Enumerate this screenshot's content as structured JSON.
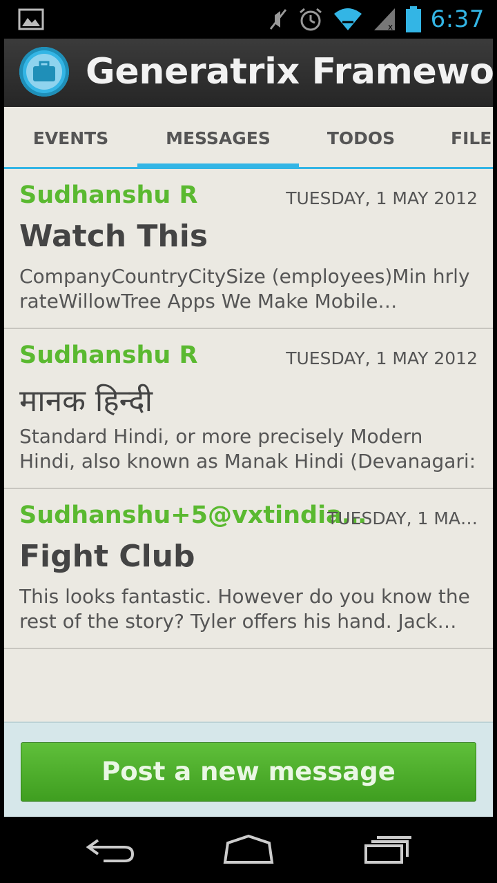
{
  "status_bar": {
    "time": "6:37",
    "icons": [
      "gallery-notification-icon",
      "mute-icon",
      "alarm-icon",
      "wifi-icon",
      "signal-icon",
      "battery-icon"
    ]
  },
  "action_bar": {
    "app_title": "Generatrix Framework",
    "app_icon": "briefcase-icon"
  },
  "tabs": [
    {
      "label": "EVENTS",
      "active": false
    },
    {
      "label": "MESSAGES",
      "active": true
    },
    {
      "label": "TODOS",
      "active": false
    },
    {
      "label": "FILE",
      "active": false
    }
  ],
  "messages": [
    {
      "from": "Sudhanshu R",
      "date": "TUESDAY, 1 MAY 2012",
      "subject": "Watch This",
      "preview": "CompanyCountryCitySize (employees)Min hrly rateWillowTree Apps We Make Mobile…"
    },
    {
      "from": "Sudhanshu R",
      "date": "TUESDAY, 1 MAY 2012",
      "subject": "मानक हिन्दी",
      "preview": "Standard Hindi, or more precisely Modern Hindi, also known as Manak Hindi (Devanagari: मानक…"
    },
    {
      "from": "Sudhanshu+5@vxtindia…",
      "date": "TUESDAY, 1 MA…",
      "subject": "Fight Club",
      "preview": "This looks fantastic. However do you know the rest of the story? Tyler offers his hand. Jack…"
    }
  ],
  "bottom_bar": {
    "post_button_label": "Post a new message"
  },
  "nav_bar": {
    "buttons": [
      "back-icon",
      "home-icon",
      "recent-apps-icon"
    ]
  },
  "colors": {
    "accent": "#33b5e5",
    "sender": "#5ab930",
    "button": "#4aab28",
    "background": "#ebe9e2"
  }
}
